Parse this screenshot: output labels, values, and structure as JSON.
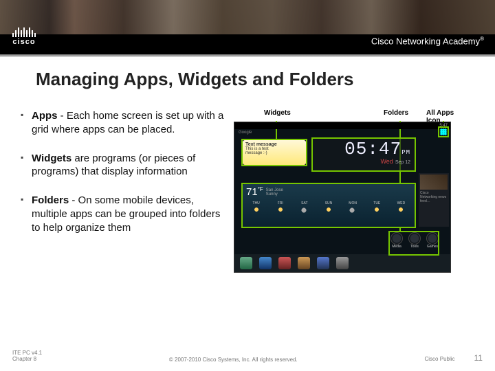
{
  "brand": {
    "name": "cisco",
    "program": "Cisco Networking Academy",
    "tm": "®"
  },
  "slide": {
    "title": "Managing Apps, Widgets and Folders",
    "bullets": [
      {
        "term": "Apps",
        "sep": "  - ",
        "text": "Each home screen is set up with a grid where apps can be placed."
      },
      {
        "term": "Widgets",
        "sep": " ",
        "text": "are programs (or pieces of programs) that display information"
      },
      {
        "term": "Folders",
        "sep": " - ",
        "text": "On some mobile devices, multiple apps can be grouped into folders to help organize them"
      }
    ]
  },
  "figure": {
    "labels": {
      "widgets": "Widgets",
      "folders": "Folders",
      "all_apps": "All Apps Icon"
    },
    "status": {
      "left": "Google",
      "right": "5:47"
    },
    "search_hint": "Google",
    "sms": {
      "title": "Text message",
      "line1": "This is a test",
      "line2": "message :-)"
    },
    "clock": {
      "time": "05:47",
      "ampm": "PM",
      "day": "Wed",
      "date": "Sep 12"
    },
    "weather": {
      "temp": "71",
      "unit": "°F",
      "city": "San Jose",
      "cond": "Sunny",
      "days": [
        "THU",
        "FRI",
        "SAT",
        "SUN",
        "MON",
        "TUE",
        "WED"
      ]
    },
    "news": {
      "headline": "Cisco",
      "sub": "Networking news feed…"
    },
    "folders": [
      "Media",
      "Tools",
      "Games"
    ]
  },
  "footer": {
    "left1": "ITE PC v4.1",
    "left2": "Chapter 8",
    "copyright": "© 2007-2010 Cisco Systems, Inc. All rights reserved.",
    "classification": "Cisco Public",
    "page": "11"
  }
}
